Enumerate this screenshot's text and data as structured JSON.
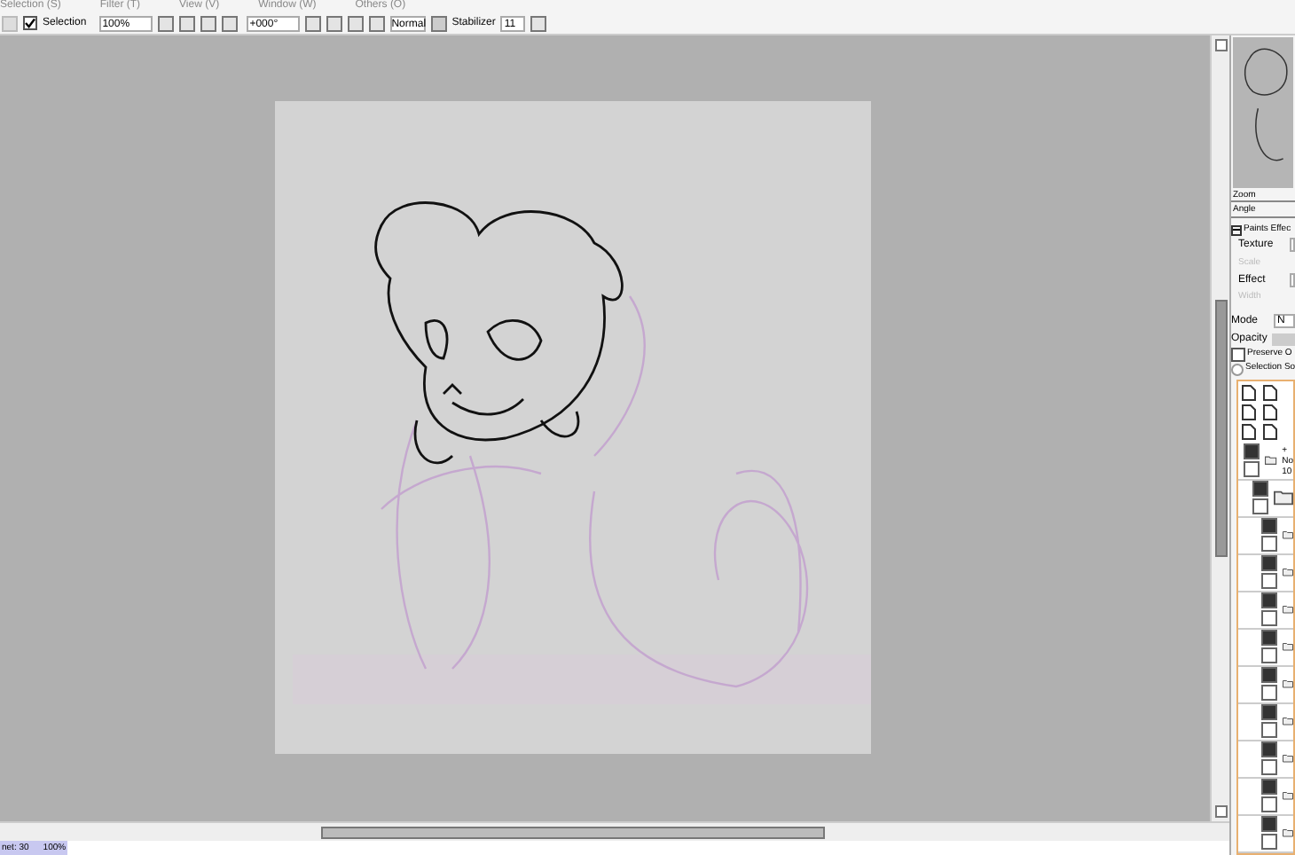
{
  "menu": [
    "Selection (S)",
    "Filter (T)",
    "View (V)",
    "Window (W)",
    "Others (O)"
  ],
  "toolbar": {
    "selection": {
      "label": "Selection",
      "checked": true
    },
    "zoom": "100%",
    "angle": "+000°",
    "blend": "Normal",
    "stabilizer_label": "Stabilizer",
    "stabilizer": "11"
  },
  "navigator": {
    "zoom": "Zoom",
    "angle": "Angle"
  },
  "paint_effects": {
    "title": "Paints Effec",
    "expanded": true,
    "rows": [
      {
        "label": "Texture",
        "disabled": false
      },
      {
        "label": "Scale",
        "disabled": true
      },
      {
        "label": "Effect",
        "disabled": false
      },
      {
        "label": "Width",
        "disabled": true
      }
    ]
  },
  "layer_props": {
    "mode_label": "Mode",
    "mode": "N",
    "opacity": {
      "label": "Opacity",
      "level": 1
    },
    "preserve": {
      "label": "Preserve O",
      "checked": false
    },
    "selection_source": {
      "label": "Selection So",
      "selected": false
    }
  },
  "layers": [
    {
      "visible": true,
      "lines": [
        "+",
        "No",
        "10"
      ],
      "children": [
        {
          "visible": true,
          "children": [
            {
              "visible": true
            },
            {
              "visible": true
            },
            {
              "visible": true
            },
            {
              "visible": true
            },
            {
              "visible": true
            },
            {
              "visible": true
            },
            {
              "visible": true
            },
            {
              "visible": true
            },
            {
              "visible": true
            }
          ]
        }
      ]
    }
  ],
  "status_bar": {
    "memory": "net: 30",
    "percent": "100%"
  }
}
